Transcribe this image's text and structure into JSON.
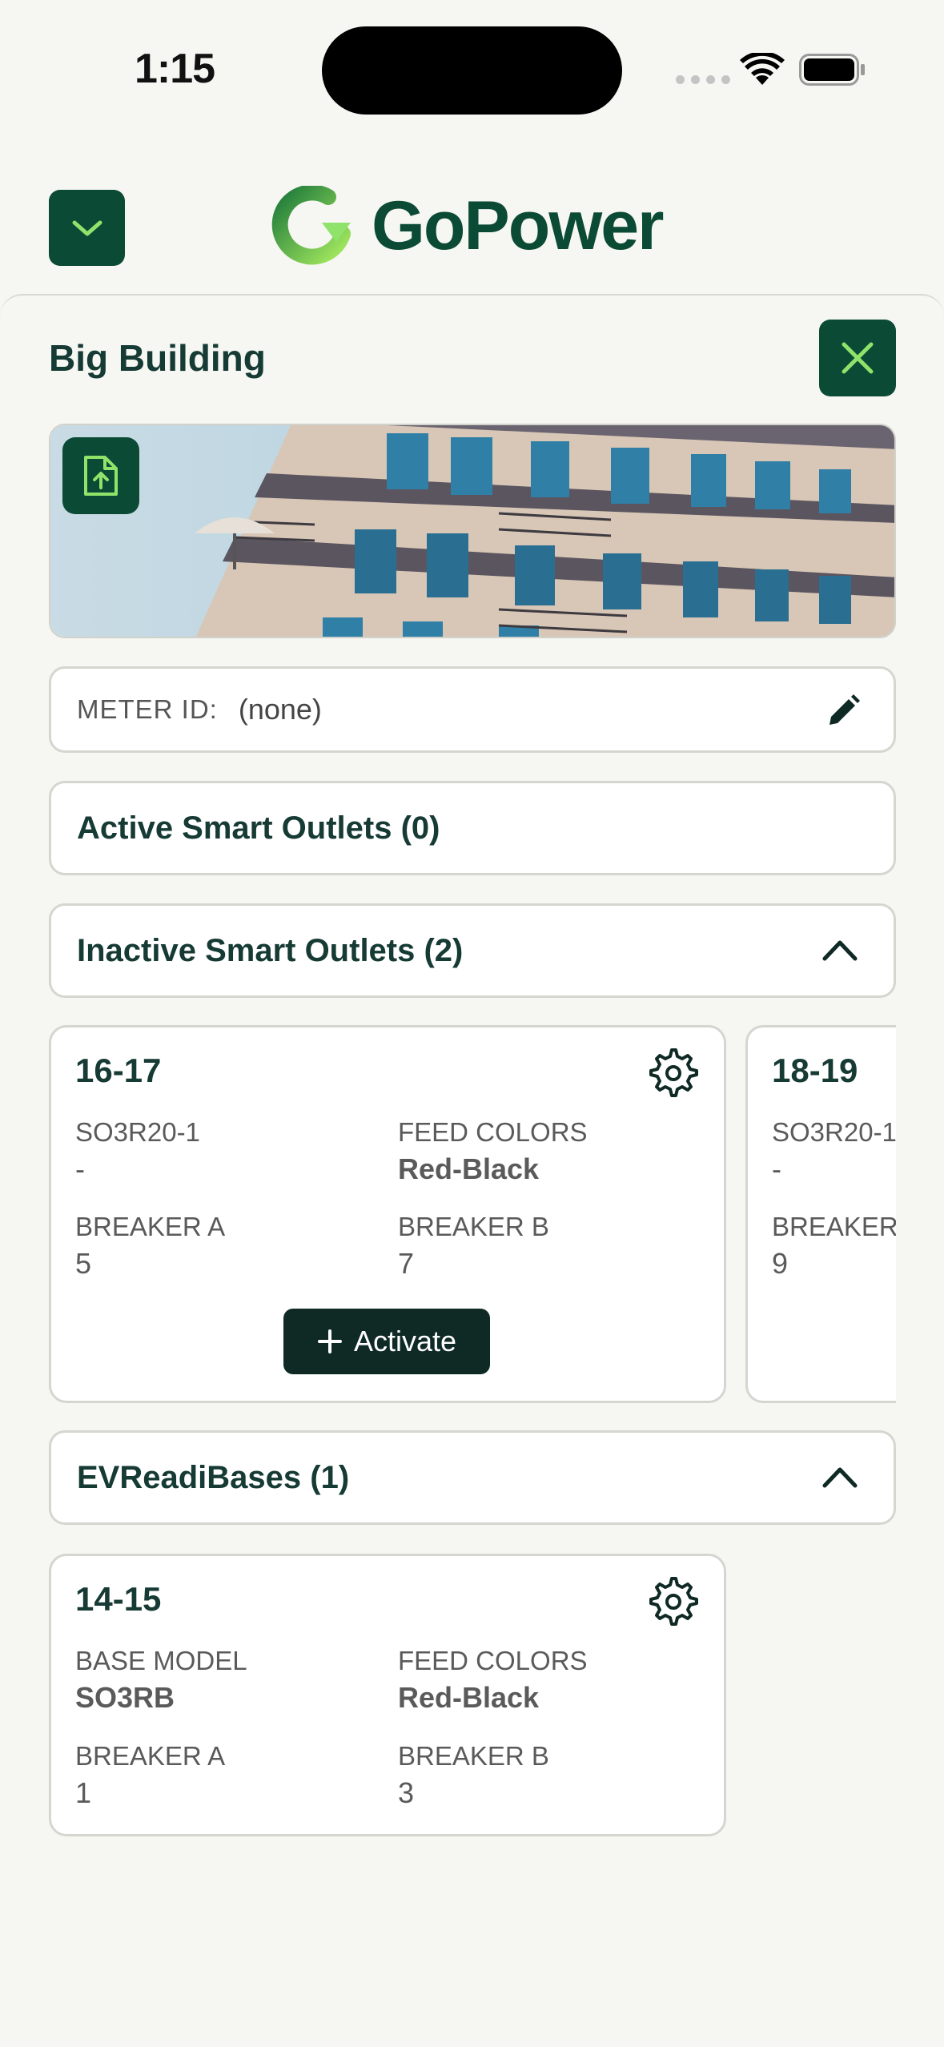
{
  "status_bar": {
    "time": "1:15"
  },
  "header": {
    "logo_text": "GoPower",
    "menu_icon": "chevron-down-icon"
  },
  "sheet": {
    "title": "Big Building",
    "close_icon": "close-icon",
    "upload_icon": "file-upload-icon",
    "meter": {
      "label": "METER ID:",
      "value": "(none)"
    }
  },
  "sections": {
    "active": {
      "title": "Active Smart Outlets (0)"
    },
    "inactive": {
      "title": "Inactive Smart Outlets (2)",
      "cards": [
        {
          "name": "16-17",
          "model_label": "SO3R20-1",
          "model_value": "-",
          "feed_label": "FEED COLORS",
          "feed_value": "Red-Black",
          "breaker_a_label": "BREAKER A",
          "breaker_a_value": "5",
          "breaker_b_label": "BREAKER B",
          "breaker_b_value": "7",
          "action": "Activate"
        },
        {
          "name": "18-19",
          "model_label": "SO3R20-1",
          "model_value": "-",
          "breaker_a_label": "BREAKER A",
          "breaker_a_value": "9"
        }
      ]
    },
    "evreadi": {
      "title": "EVReadiBases (1)",
      "cards": [
        {
          "name": "14-15",
          "model_label": "BASE MODEL",
          "model_value": "SO3RB",
          "feed_label": "FEED COLORS",
          "feed_value": "Red-Black",
          "breaker_a_label": "BREAKER A",
          "breaker_a_value": "1",
          "breaker_b_label": "BREAKER B",
          "breaker_b_value": "3"
        }
      ]
    }
  },
  "colors": {
    "brand_dark": "#0b4a35",
    "brand_light": "#8fe36a",
    "button_dark": "#0f2a25"
  }
}
